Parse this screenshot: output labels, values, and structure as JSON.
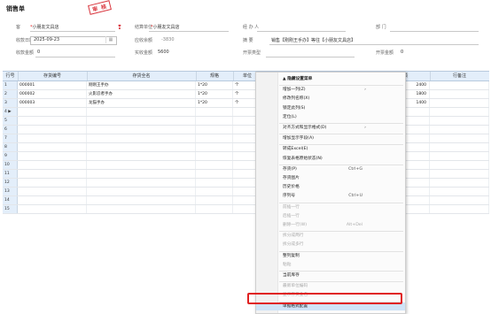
{
  "page": {
    "title": "销售单",
    "stamp": "审 核"
  },
  "form": {
    "customer_label": "客",
    "customer_value": "小朋友文具店",
    "settle_label": "结算单位",
    "settle_value": "小朋友文具店",
    "handler_label": "经 办 人",
    "dept_label": "部 门",
    "date_label": "收款日期",
    "date_value": "2025-09-23",
    "balance_label": "应收余额",
    "balance_value": "-3830",
    "summary_label": "摘 要",
    "summary_value": "销售【刚刚王手办】等往【小朋友文具店】",
    "paid_label": "收款金额",
    "paid_value": "0",
    "discount_label": "实收金额",
    "discount_value": "5600",
    "invoice_label": "开票类型",
    "bill_label": "开票金额",
    "bill_value": "0"
  },
  "grid": {
    "headers": [
      "行号",
      "存货编号",
      "存货全名",
      "规格",
      "单位",
      "",
      "金额",
      "行备注"
    ],
    "rows": [
      {
        "no": "1",
        "code": "000001",
        "name": "刚刚王手办",
        "spec": "1*20",
        "unit": "个",
        "qty": "20",
        "amount": "2400"
      },
      {
        "no": "2",
        "code": "000002",
        "name": "火影忍者手办",
        "spec": "1*20",
        "unit": "个",
        "qty": "20",
        "amount": "1800"
      },
      {
        "no": "3",
        "code": "000003",
        "name": "龙猫手办",
        "spec": "1*20",
        "unit": "个",
        "qty": "20",
        "amount": "1400"
      },
      {
        "no": "4 ▶",
        "code": "",
        "name": "",
        "spec": "",
        "unit": "",
        "qty": "",
        "amount": ""
      },
      {
        "no": "5"
      },
      {
        "no": "6"
      },
      {
        "no": "7"
      },
      {
        "no": "8"
      },
      {
        "no": "9"
      },
      {
        "no": "10"
      },
      {
        "no": "11"
      },
      {
        "no": "12"
      },
      {
        "no": "13"
      },
      {
        "no": "14"
      },
      {
        "no": "15"
      }
    ]
  },
  "menu": {
    "items": [
      {
        "label": "▲ 隐藏设置菜单",
        "bold": true
      },
      {
        "label": "增加一列(Z)",
        "arrow": "›"
      },
      {
        "label": "修改列名称(X)"
      },
      {
        "label": "锁定此列(S)"
      },
      {
        "label": "定位(L)"
      },
      {
        "label": "对齐方式和显示格式(D)",
        "arrow": "›"
      },
      {
        "label": "增加显示字段(A)"
      },
      {
        "label": "转成Excel(E)"
      },
      {
        "label": "恢复表格原始状态(N)"
      },
      {
        "label": "存货(P)",
        "key": "Ctrl+G"
      },
      {
        "label": "存货图片"
      },
      {
        "label": "历史价格"
      },
      {
        "label": "序列号",
        "key": "Ctrl+U"
      },
      {
        "label": "前插一行",
        "disabled": true
      },
      {
        "label": "后插一行",
        "disabled": true
      },
      {
        "label": "删除一行(W)",
        "key": "Alt+Del",
        "disabled": true
      },
      {
        "label": "拆分成两行",
        "disabled": true
      },
      {
        "label": "拆分成多行",
        "disabled": true
      },
      {
        "label": "整列复制"
      },
      {
        "label": "粘贴",
        "disabled": true
      },
      {
        "label": "当前库存"
      },
      {
        "label": "最新单位编码",
        "disabled": true
      },
      {
        "label": "显示存货全名",
        "disabled": true
      },
      {
        "label": "单据格式配置",
        "highlight": true
      }
    ]
  }
}
